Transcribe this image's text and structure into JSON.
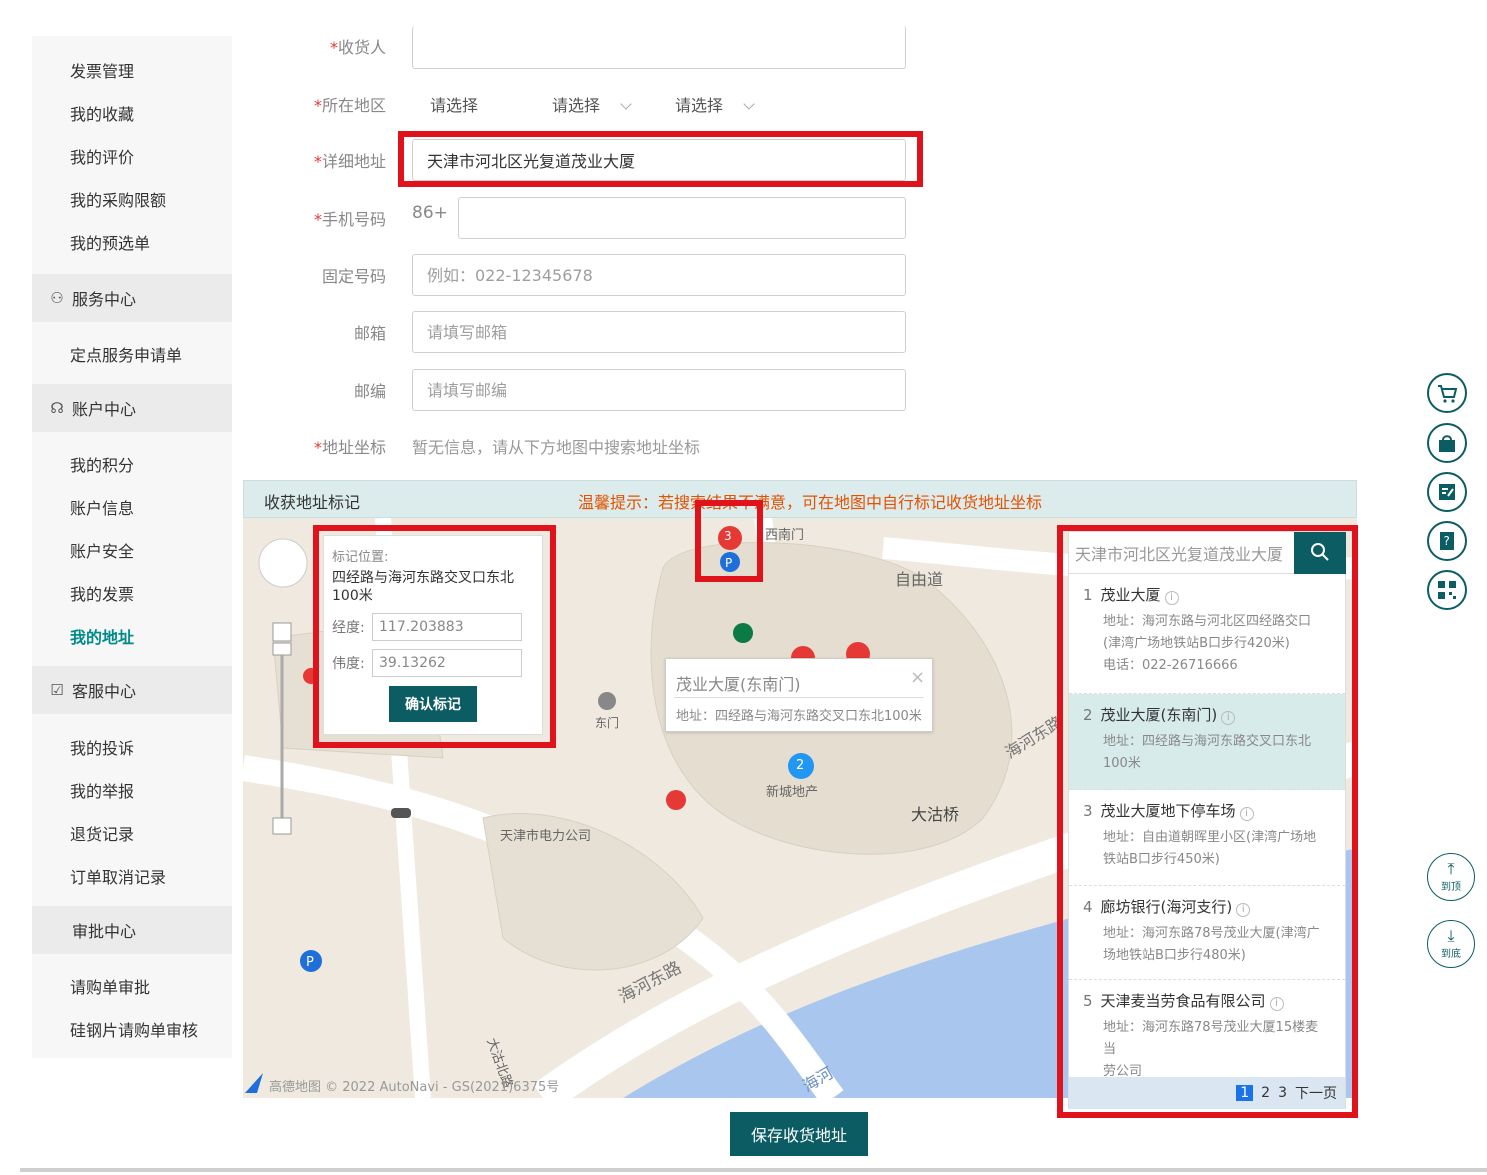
{
  "sidebar": {
    "items_top": [
      "发票管理",
      "我的收藏",
      "我的评价",
      "我的采购限额",
      "我的预选单"
    ],
    "service_center": "服务中心",
    "service_items": [
      "定点服务申请单"
    ],
    "account_center": "账户中心",
    "account_items": [
      "我的积分",
      "账户信息",
      "账户安全",
      "我的发票",
      "我的地址"
    ],
    "customer_center": "客服中心",
    "customer_items": [
      "我的投诉",
      "我的举报",
      "退货记录",
      "订单取消记录"
    ],
    "approval_center": "审批中心",
    "approval_items": [
      "请购单审批",
      "硅钢片请购单审核"
    ]
  },
  "form": {
    "receiver_label": "收货人",
    "region_label": "所在地区",
    "region_selects": [
      "请选择",
      "请选择",
      "请选择"
    ],
    "detail_label": "详细地址",
    "detail_value": "天津市河北区光复道茂业大厦",
    "phone_label": "手机号码",
    "phone_prefix": "86+",
    "landline_label": "固定号码",
    "landline_placeholder": "例如：022-12345678",
    "email_label": "邮箱",
    "email_placeholder": "请填写邮箱",
    "zip_label": "邮编",
    "zip_placeholder": "请填写邮编",
    "coord_label": "地址坐标",
    "coord_text": "暂无信息，请从下方地图中搜索地址坐标",
    "required_mark": "*"
  },
  "map": {
    "header_title": "收获地址标记",
    "header_tip": "温馨提示：若搜索结果不满意，可在地图中自行标记收货地址坐标",
    "popup": {
      "title": "标记位置:",
      "address": "四经路与海河东路交叉口东北100米",
      "lng_label": "经度:",
      "lng_value": "117.203883",
      "lat_label": "伟度:",
      "lat_value": "39.13262",
      "confirm": "确认标记"
    },
    "poi_tip": {
      "title": "茂业大厦(东南门)",
      "address": "地址：四经路与海河东路交叉口东北100米"
    },
    "labels": {
      "ximen": "西南门",
      "ziyoudao": "自由道",
      "dongmen": "东门",
      "xincheng": "新城地产",
      "power": "天津市电力公司",
      "dagu": "大沽桥",
      "haihe_road": "海河东路",
      "haihe_road2": "海河东路",
      "haihe": "海河",
      "dagu_road": "大沽北路",
      "copyright": "高德地图 © 2022 AutoNavi - GS(2021)6375号"
    },
    "markers": [
      "3",
      "2"
    ]
  },
  "search": {
    "value": "天津市河北区光复道茂业大厦",
    "results": [
      {
        "num": "1",
        "title": "茂业大厦",
        "lines": [
          "地址：海河东路与河北区四经路交口",
          "(津湾广场地铁站B口步行420米)",
          "电话：022-26716666"
        ]
      },
      {
        "num": "2",
        "title": "茂业大厦(东南门)",
        "lines": [
          "地址：四经路与海河东路交叉口东北",
          "100米"
        ]
      },
      {
        "num": "3",
        "title": "茂业大厦地下停车场",
        "lines": [
          "地址：自由道朝晖里小区(津湾广场地",
          "铁站B口步行450米)"
        ]
      },
      {
        "num": "4",
        "title": "廊坊银行(海河支行)",
        "lines": [
          "地址：海河东路78号茂业大厦(津湾广",
          "场地铁站B口步行480米)"
        ]
      },
      {
        "num": "5",
        "title": "天津麦当劳食品有限公司",
        "lines": [
          "地址：海河东路78号茂业大厦15楼麦当",
          "劳公司"
        ]
      }
    ],
    "pager": {
      "pages": [
        "1",
        "2",
        "3"
      ],
      "next": "下一页"
    }
  },
  "float": {
    "top_label": "到顶",
    "bottom_label": "到底"
  },
  "save_button": "保存收货地址",
  "colors": {
    "accent": "#0b5d63",
    "highlight": "#e0121b",
    "tip": "#e65100"
  }
}
